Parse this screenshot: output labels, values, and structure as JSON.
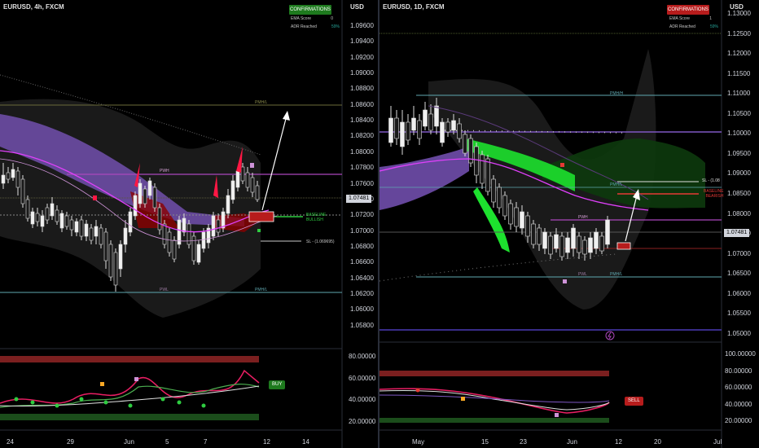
{
  "left": {
    "symbol": "EURUSD, 4h, FXCM",
    "currency": "USD",
    "confirm_label": "CONFIRMATIONS",
    "confirm_color": "#1e7a1e",
    "rows": [
      {
        "label": "EMA Score",
        "value": "0"
      },
      {
        "label": "ADR Reached",
        "value": "59%"
      }
    ],
    "y_labels": [
      "1.09600",
      "1.09400",
      "1.09200",
      "1.09000",
      "1.08800",
      "1.08600",
      "1.08400",
      "1.08200",
      "1.08000",
      "1.07800",
      "1.07600",
      "1.07400",
      "1.07200",
      "1.07000",
      "1.06800",
      "1.06600",
      "1.06400",
      "1.06200",
      "1.06000",
      "1.05800"
    ],
    "last_price": "1.07481",
    "x_labels": [
      "24",
      "29",
      "Jun",
      "5",
      "7",
      "12",
      "14"
    ],
    "osc_labels": [
      "80.00000",
      "60.00000",
      "40.00000",
      "20.00000"
    ],
    "level_labels": {
      "pmh": "PMH/L",
      "pwh": "PWH",
      "pwl": "PWL",
      "pmhl": "PMH/L"
    },
    "baseline": "BASELINE\nBULLISH",
    "sl": "SL - (1.069695)",
    "signal": "BUY",
    "signal_color": "#1e7a1e"
  },
  "right": {
    "symbol": "EURUSD, 1D, FXCM",
    "currency": "USD",
    "confirm_label": "CONFIRMATIONS",
    "confirm_color": "#b71c1c",
    "rows": [
      {
        "label": "EMA Score",
        "value": "1"
      },
      {
        "label": "ADR Reached",
        "value": "59%"
      }
    ],
    "y_labels": [
      "1.13000",
      "1.12500",
      "1.12000",
      "1.11500",
      "1.11000",
      "1.10500",
      "1.10000",
      "1.09500",
      "1.09000",
      "1.08500",
      "1.08000",
      "1.07500",
      "1.07000",
      "1.06500",
      "1.06000",
      "1.05500",
      "1.05000"
    ],
    "last_price": "1.07481",
    "x_labels": [
      "May",
      "15",
      "23",
      "Jun",
      "12",
      "20",
      "Jul"
    ],
    "osc_labels": [
      "100.00000",
      "80.00000",
      "60.00000",
      "40.00000",
      "20.00000"
    ],
    "level_labels": {
      "pmh": "PMH/H",
      "pwh": "PWH",
      "pwl": "PWL",
      "pmhl": "PMH/L",
      "pmhl2": "PMH/L"
    },
    "baseline": "BASELINE\nBEARISH",
    "sl": "SL - (1.08",
    "signal": "SELL",
    "signal_color": "#b71c1c"
  }
}
